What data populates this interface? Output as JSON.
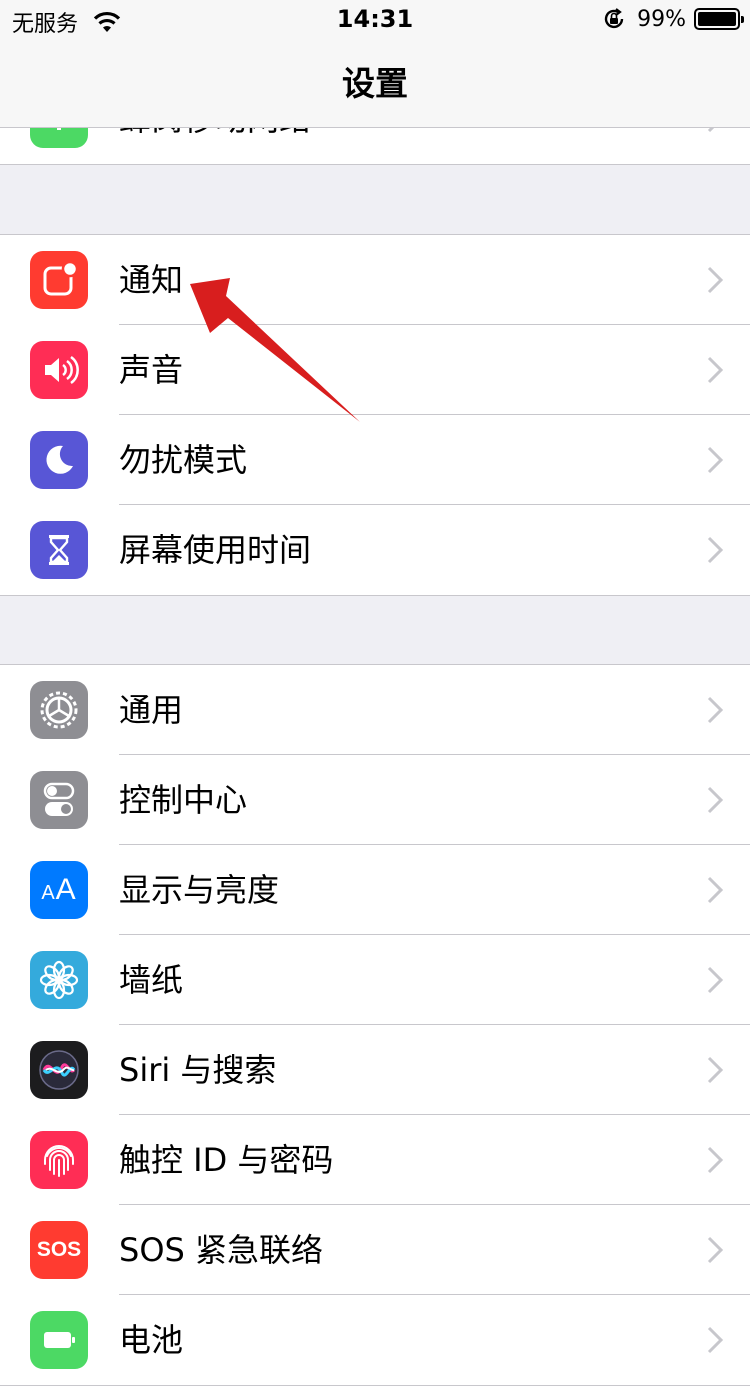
{
  "status_bar": {
    "carrier": "无服务",
    "time": "14:31",
    "battery": "99%"
  },
  "nav": {
    "title": "设置"
  },
  "partial_top_label": "蜂窝移动网络",
  "group1": [
    {
      "label": "通知",
      "icon": "notifications-icon",
      "color": "#ff3b30"
    },
    {
      "label": "声音",
      "icon": "speaker-icon",
      "color": "#ff2d55"
    },
    {
      "label": "勿扰模式",
      "icon": "moon-icon",
      "color": "#5856d6"
    },
    {
      "label": "屏幕使用时间",
      "icon": "hourglass-icon",
      "color": "#5856d6"
    }
  ],
  "group2": [
    {
      "label": "通用",
      "icon": "gear-icon",
      "color": "#8e8e93"
    },
    {
      "label": "控制中心",
      "icon": "toggles-icon",
      "color": "#8e8e93"
    },
    {
      "label": "显示与亮度",
      "icon": "text-size-icon",
      "color": "#007aff",
      "icon_text": "AA"
    },
    {
      "label": "墙纸",
      "icon": "flower-icon",
      "color": "#34aadc"
    },
    {
      "label": "Siri 与搜索",
      "icon": "siri-icon",
      "color": "#1c1c1e"
    },
    {
      "label": "触控 ID 与密码",
      "icon": "fingerprint-icon",
      "color": "#ff2d55"
    },
    {
      "label": "SOS 紧急联络",
      "icon": "sos-icon",
      "color": "#ff3b30",
      "icon_text": "SOS"
    },
    {
      "label": "电池",
      "icon": "battery-icon",
      "color": "#4cd964"
    }
  ]
}
